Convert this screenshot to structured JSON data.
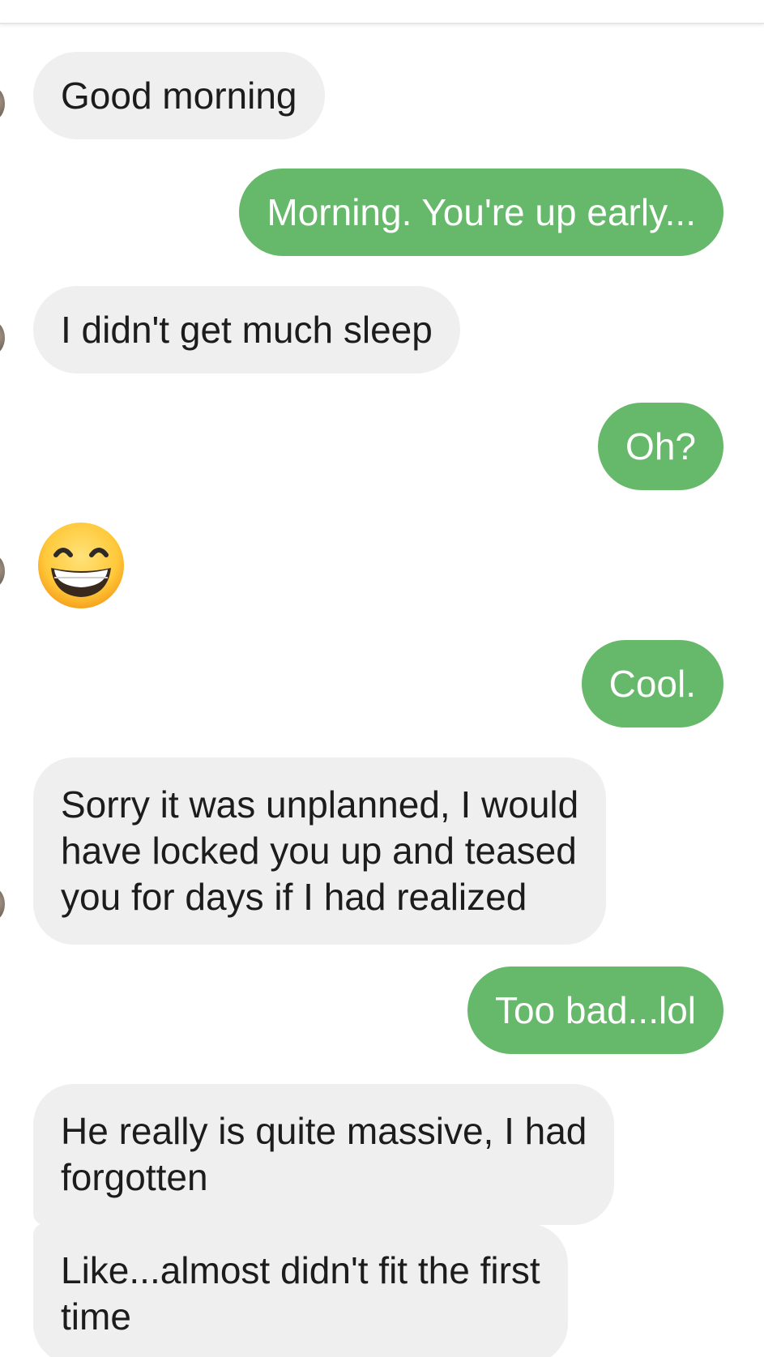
{
  "messages": [
    {
      "from": "them",
      "text": "Good morning"
    },
    {
      "from": "me",
      "text": "Morning. You're up early..."
    },
    {
      "from": "them",
      "text": "I didn't get much sleep"
    },
    {
      "from": "me",
      "text": "Oh?"
    },
    {
      "from": "them",
      "emoji": "beaming-face-with-smiling-eyes"
    },
    {
      "from": "me",
      "text": "Cool."
    },
    {
      "from": "them",
      "lines": [
        "Sorry it was unplanned, I would",
        "have locked you up and teased",
        "you for days if I had realized"
      ]
    },
    {
      "from": "me",
      "text": "Too bad...lol"
    },
    {
      "from": "them",
      "lines": [
        "He really is quite massive, I had",
        "forgotten"
      ]
    },
    {
      "from": "them",
      "lines": [
        "Like...almost didn't fit the first",
        "time"
      ]
    }
  ],
  "colors": {
    "incoming_bubble": "#efefef",
    "outgoing_bubble": "#66b96a",
    "incoming_text": "#1c1c1c",
    "outgoing_text": "#ffffff"
  },
  "icons": {
    "avatar": "contact-avatar",
    "emoji": "beaming-face-with-smiling-eyes"
  }
}
